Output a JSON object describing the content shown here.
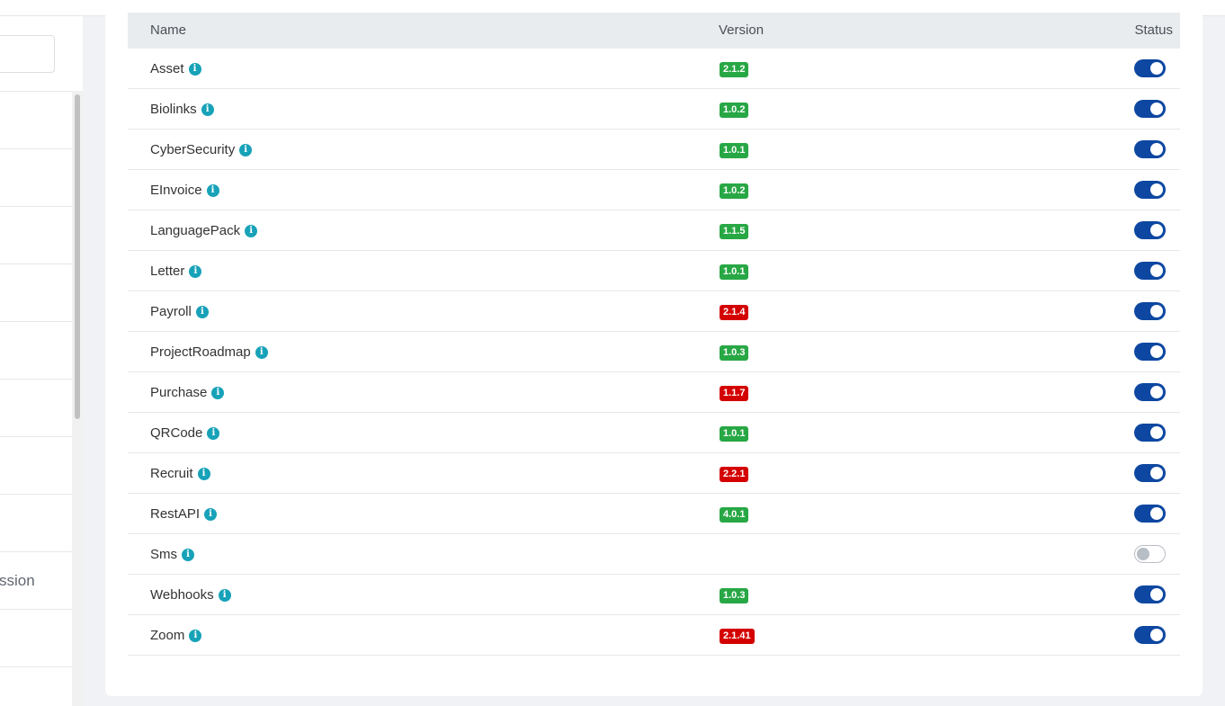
{
  "sidebar": {
    "search_value": "",
    "items": [
      "",
      "",
      "",
      "",
      "",
      "",
      "",
      "",
      "ssion",
      "",
      ""
    ]
  },
  "table": {
    "headers": {
      "name": "Name",
      "version": "Version",
      "status": "Status"
    },
    "rows": [
      {
        "name": "Asset",
        "version": "2.1.2",
        "version_color": "#28a745",
        "enabled": true
      },
      {
        "name": "Biolinks",
        "version": "1.0.2",
        "version_color": "#28a745",
        "enabled": true
      },
      {
        "name": "CyberSecurity",
        "version": "1.0.1",
        "version_color": "#28a745",
        "enabled": true
      },
      {
        "name": "EInvoice",
        "version": "1.0.2",
        "version_color": "#28a745",
        "enabled": true
      },
      {
        "name": "LanguagePack",
        "version": "1.1.5",
        "version_color": "#28a745",
        "enabled": true
      },
      {
        "name": "Letter",
        "version": "1.0.1",
        "version_color": "#28a745",
        "enabled": true
      },
      {
        "name": "Payroll",
        "version": "2.1.4",
        "version_color": "#d40000",
        "enabled": true
      },
      {
        "name": "ProjectRoadmap",
        "version": "1.0.3",
        "version_color": "#28a745",
        "enabled": true
      },
      {
        "name": "Purchase",
        "version": "1.1.7",
        "version_color": "#d40000",
        "enabled": true
      },
      {
        "name": "QRCode",
        "version": "1.0.1",
        "version_color": "#28a745",
        "enabled": true
      },
      {
        "name": "Recruit",
        "version": "2.2.1",
        "version_color": "#d40000",
        "enabled": true
      },
      {
        "name": "RestAPI",
        "version": "4.0.1",
        "version_color": "#28a745",
        "enabled": true
      },
      {
        "name": "Sms",
        "version": "",
        "version_color": "",
        "enabled": false
      },
      {
        "name": "Webhooks",
        "version": "1.0.3",
        "version_color": "#28a745",
        "enabled": true
      },
      {
        "name": "Zoom",
        "version": "2.1.41",
        "version_color": "#d40000",
        "enabled": true
      }
    ]
  },
  "icons": {
    "info": "info-circle-icon",
    "info_glyph": "i"
  },
  "colors": {
    "toggle_on": "#0d47a1",
    "info": "#17a2b8",
    "badge_green": "#28a745",
    "badge_red": "#d40000"
  }
}
